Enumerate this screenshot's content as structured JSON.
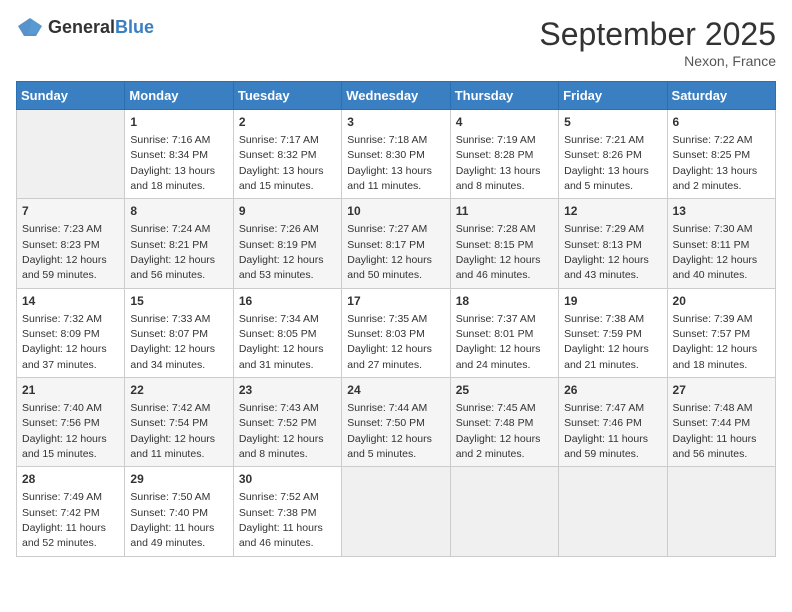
{
  "header": {
    "logo_general": "General",
    "logo_blue": "Blue",
    "month_title": "September 2025",
    "location": "Nexon, France"
  },
  "days_of_week": [
    "Sunday",
    "Monday",
    "Tuesday",
    "Wednesday",
    "Thursday",
    "Friday",
    "Saturday"
  ],
  "weeks": [
    [
      {
        "day": "",
        "info": ""
      },
      {
        "day": "1",
        "info": "Sunrise: 7:16 AM\nSunset: 8:34 PM\nDaylight: 13 hours\nand 18 minutes."
      },
      {
        "day": "2",
        "info": "Sunrise: 7:17 AM\nSunset: 8:32 PM\nDaylight: 13 hours\nand 15 minutes."
      },
      {
        "day": "3",
        "info": "Sunrise: 7:18 AM\nSunset: 8:30 PM\nDaylight: 13 hours\nand 11 minutes."
      },
      {
        "day": "4",
        "info": "Sunrise: 7:19 AM\nSunset: 8:28 PM\nDaylight: 13 hours\nand 8 minutes."
      },
      {
        "day": "5",
        "info": "Sunrise: 7:21 AM\nSunset: 8:26 PM\nDaylight: 13 hours\nand 5 minutes."
      },
      {
        "day": "6",
        "info": "Sunrise: 7:22 AM\nSunset: 8:25 PM\nDaylight: 13 hours\nand 2 minutes."
      }
    ],
    [
      {
        "day": "7",
        "info": "Sunrise: 7:23 AM\nSunset: 8:23 PM\nDaylight: 12 hours\nand 59 minutes."
      },
      {
        "day": "8",
        "info": "Sunrise: 7:24 AM\nSunset: 8:21 PM\nDaylight: 12 hours\nand 56 minutes."
      },
      {
        "day": "9",
        "info": "Sunrise: 7:26 AM\nSunset: 8:19 PM\nDaylight: 12 hours\nand 53 minutes."
      },
      {
        "day": "10",
        "info": "Sunrise: 7:27 AM\nSunset: 8:17 PM\nDaylight: 12 hours\nand 50 minutes."
      },
      {
        "day": "11",
        "info": "Sunrise: 7:28 AM\nSunset: 8:15 PM\nDaylight: 12 hours\nand 46 minutes."
      },
      {
        "day": "12",
        "info": "Sunrise: 7:29 AM\nSunset: 8:13 PM\nDaylight: 12 hours\nand 43 minutes."
      },
      {
        "day": "13",
        "info": "Sunrise: 7:30 AM\nSunset: 8:11 PM\nDaylight: 12 hours\nand 40 minutes."
      }
    ],
    [
      {
        "day": "14",
        "info": "Sunrise: 7:32 AM\nSunset: 8:09 PM\nDaylight: 12 hours\nand 37 minutes."
      },
      {
        "day": "15",
        "info": "Sunrise: 7:33 AM\nSunset: 8:07 PM\nDaylight: 12 hours\nand 34 minutes."
      },
      {
        "day": "16",
        "info": "Sunrise: 7:34 AM\nSunset: 8:05 PM\nDaylight: 12 hours\nand 31 minutes."
      },
      {
        "day": "17",
        "info": "Sunrise: 7:35 AM\nSunset: 8:03 PM\nDaylight: 12 hours\nand 27 minutes."
      },
      {
        "day": "18",
        "info": "Sunrise: 7:37 AM\nSunset: 8:01 PM\nDaylight: 12 hours\nand 24 minutes."
      },
      {
        "day": "19",
        "info": "Sunrise: 7:38 AM\nSunset: 7:59 PM\nDaylight: 12 hours\nand 21 minutes."
      },
      {
        "day": "20",
        "info": "Sunrise: 7:39 AM\nSunset: 7:57 PM\nDaylight: 12 hours\nand 18 minutes."
      }
    ],
    [
      {
        "day": "21",
        "info": "Sunrise: 7:40 AM\nSunset: 7:56 PM\nDaylight: 12 hours\nand 15 minutes."
      },
      {
        "day": "22",
        "info": "Sunrise: 7:42 AM\nSunset: 7:54 PM\nDaylight: 12 hours\nand 11 minutes."
      },
      {
        "day": "23",
        "info": "Sunrise: 7:43 AM\nSunset: 7:52 PM\nDaylight: 12 hours\nand 8 minutes."
      },
      {
        "day": "24",
        "info": "Sunrise: 7:44 AM\nSunset: 7:50 PM\nDaylight: 12 hours\nand 5 minutes."
      },
      {
        "day": "25",
        "info": "Sunrise: 7:45 AM\nSunset: 7:48 PM\nDaylight: 12 hours\nand 2 minutes."
      },
      {
        "day": "26",
        "info": "Sunrise: 7:47 AM\nSunset: 7:46 PM\nDaylight: 11 hours\nand 59 minutes."
      },
      {
        "day": "27",
        "info": "Sunrise: 7:48 AM\nSunset: 7:44 PM\nDaylight: 11 hours\nand 56 minutes."
      }
    ],
    [
      {
        "day": "28",
        "info": "Sunrise: 7:49 AM\nSunset: 7:42 PM\nDaylight: 11 hours\nand 52 minutes."
      },
      {
        "day": "29",
        "info": "Sunrise: 7:50 AM\nSunset: 7:40 PM\nDaylight: 11 hours\nand 49 minutes."
      },
      {
        "day": "30",
        "info": "Sunrise: 7:52 AM\nSunset: 7:38 PM\nDaylight: 11 hours\nand 46 minutes."
      },
      {
        "day": "",
        "info": ""
      },
      {
        "day": "",
        "info": ""
      },
      {
        "day": "",
        "info": ""
      },
      {
        "day": "",
        "info": ""
      }
    ]
  ]
}
